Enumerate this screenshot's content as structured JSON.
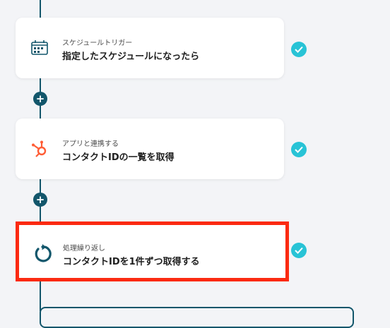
{
  "colors": {
    "background": "#f3f4f7",
    "line": "#12566b",
    "check": "#28c3d6",
    "highlight_border": "#fb2a10",
    "hubspot": "#ff5c35"
  },
  "steps": [
    {
      "subtitle": "スケジュールトリガー",
      "title": "指定したスケジュールになったら",
      "icon": "calendar-icon",
      "status": "done"
    },
    {
      "subtitle": "アプリと連携する",
      "title": "コンタクトIDの一覧を取得",
      "icon": "hubspot-icon",
      "status": "done"
    },
    {
      "subtitle": "処理繰り返し",
      "title": "コンタクトIDを1件ずつ取得する",
      "icon": "loop-icon",
      "status": "done"
    }
  ]
}
